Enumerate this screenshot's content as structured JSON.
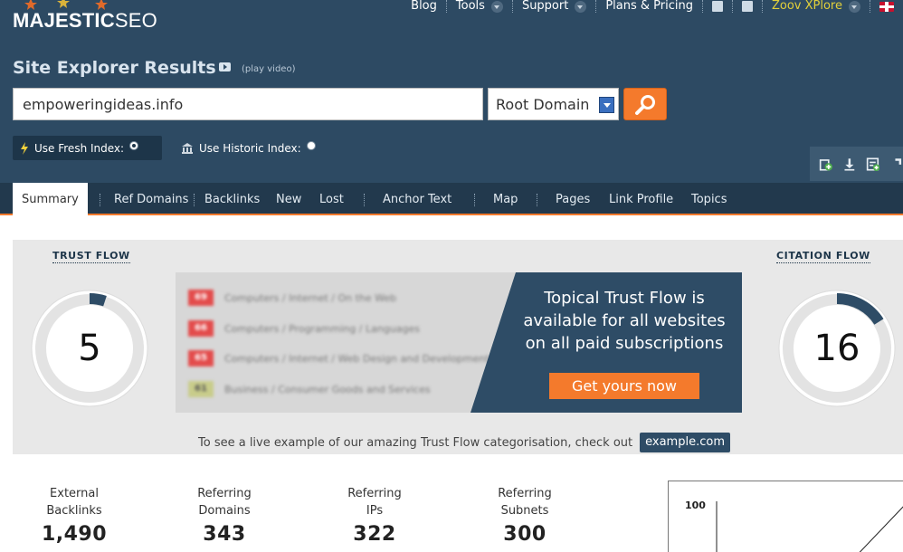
{
  "brand": {
    "name_main": "MAJESTIC",
    "name_sub": "SEO"
  },
  "topnav": {
    "blog": "Blog",
    "tools": "Tools",
    "support": "Support",
    "plans": "Plans & Pricing",
    "user": "Zoov XPlore"
  },
  "page": {
    "title": "Site Explorer Results",
    "play_video": "(play video)"
  },
  "search": {
    "value": "empoweringideas.info",
    "scope": "Root Domain"
  },
  "index": {
    "fresh_label": "Use Fresh Index:",
    "historic_label": "Use Historic Index:",
    "selected": "fresh"
  },
  "tabs": [
    "Summary",
    "Ref Domains",
    "Backlinks",
    "New",
    "Lost",
    "Anchor Text",
    "Map",
    "Pages",
    "Link Profile",
    "Topics"
  ],
  "trust_flow": {
    "label": "TRUST FLOW",
    "value": 5
  },
  "citation_flow": {
    "label": "CITATION FLOW",
    "value": 16
  },
  "promo": {
    "categories": [
      {
        "score": "69",
        "topic": "Computers / Internet / On the Web",
        "color": "red"
      },
      {
        "score": "66",
        "topic": "Computers / Programming / Languages",
        "color": "red"
      },
      {
        "score": "65",
        "topic": "Computers / Internet / Web Design and Development",
        "color": "red"
      },
      {
        "score": "61",
        "topic": "Business / Consumer Goods and Services",
        "color": "green"
      }
    ],
    "line1": "Topical Trust Flow is",
    "line2": "available for all websites",
    "line3": "on all paid subscriptions",
    "button": "Get yours now"
  },
  "live_example": {
    "text": "To see a live example of our amazing Trust Flow categorisation, check out",
    "link": "example.com"
  },
  "stats": [
    {
      "line1": "External",
      "line2": "Backlinks",
      "value": "1,490"
    },
    {
      "line1": "Referring",
      "line2": "Domains",
      "value": "343"
    },
    {
      "line1": "Referring",
      "line2": "IPs",
      "value": "322"
    },
    {
      "line1": "Referring",
      "line2": "Subnets",
      "value": "300"
    }
  ],
  "chart_data": {
    "type": "line",
    "y_tick_labels": [
      "100"
    ]
  },
  "colors": {
    "header": "#2d4a63",
    "accent": "#f47a2c",
    "tabbar": "#22394d",
    "user": "#e2d03a"
  }
}
